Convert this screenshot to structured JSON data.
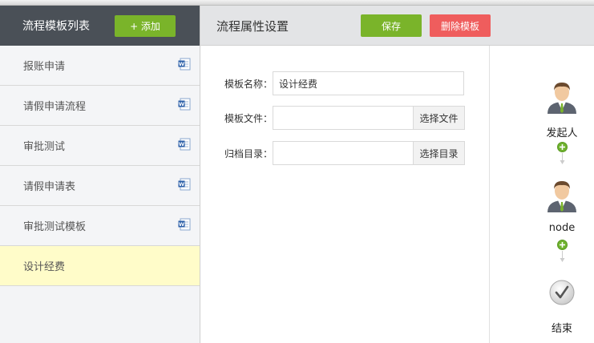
{
  "sidebar": {
    "title": "流程模板列表",
    "add_label": "+ 添加",
    "items": [
      {
        "label": "报账申请",
        "icon": "word-doc-icon"
      },
      {
        "label": "请假申请流程",
        "icon": "word-doc-icon"
      },
      {
        "label": "审批测试",
        "icon": "word-doc-icon"
      },
      {
        "label": "请假申请表",
        "icon": "word-doc-icon"
      },
      {
        "label": "审批测试模板",
        "icon": "word-doc-icon"
      },
      {
        "label": "设计经费",
        "selected": true
      }
    ]
  },
  "header": {
    "title": "流程属性设置",
    "save_label": "保存",
    "delete_label": "删除模板"
  },
  "form": {
    "name_label": "模板名称：",
    "name_value": "设计经费",
    "file_label": "模板文件：",
    "file_value": "",
    "file_button": "选择文件",
    "dir_label": "归档目录：",
    "dir_value": "",
    "dir_button": "选择目录"
  },
  "flow": {
    "nodes": [
      {
        "label": "发起人",
        "icon": "user-avatar-icon"
      },
      {
        "label": "node",
        "icon": "user-avatar-icon"
      },
      {
        "label": "结束",
        "icon": "checkmark-end-icon"
      }
    ]
  },
  "colors": {
    "sidebar_header": "#4a5057",
    "green": "#7ab42a",
    "red": "#ef5d5d",
    "selected_item": "#fffcc9"
  }
}
